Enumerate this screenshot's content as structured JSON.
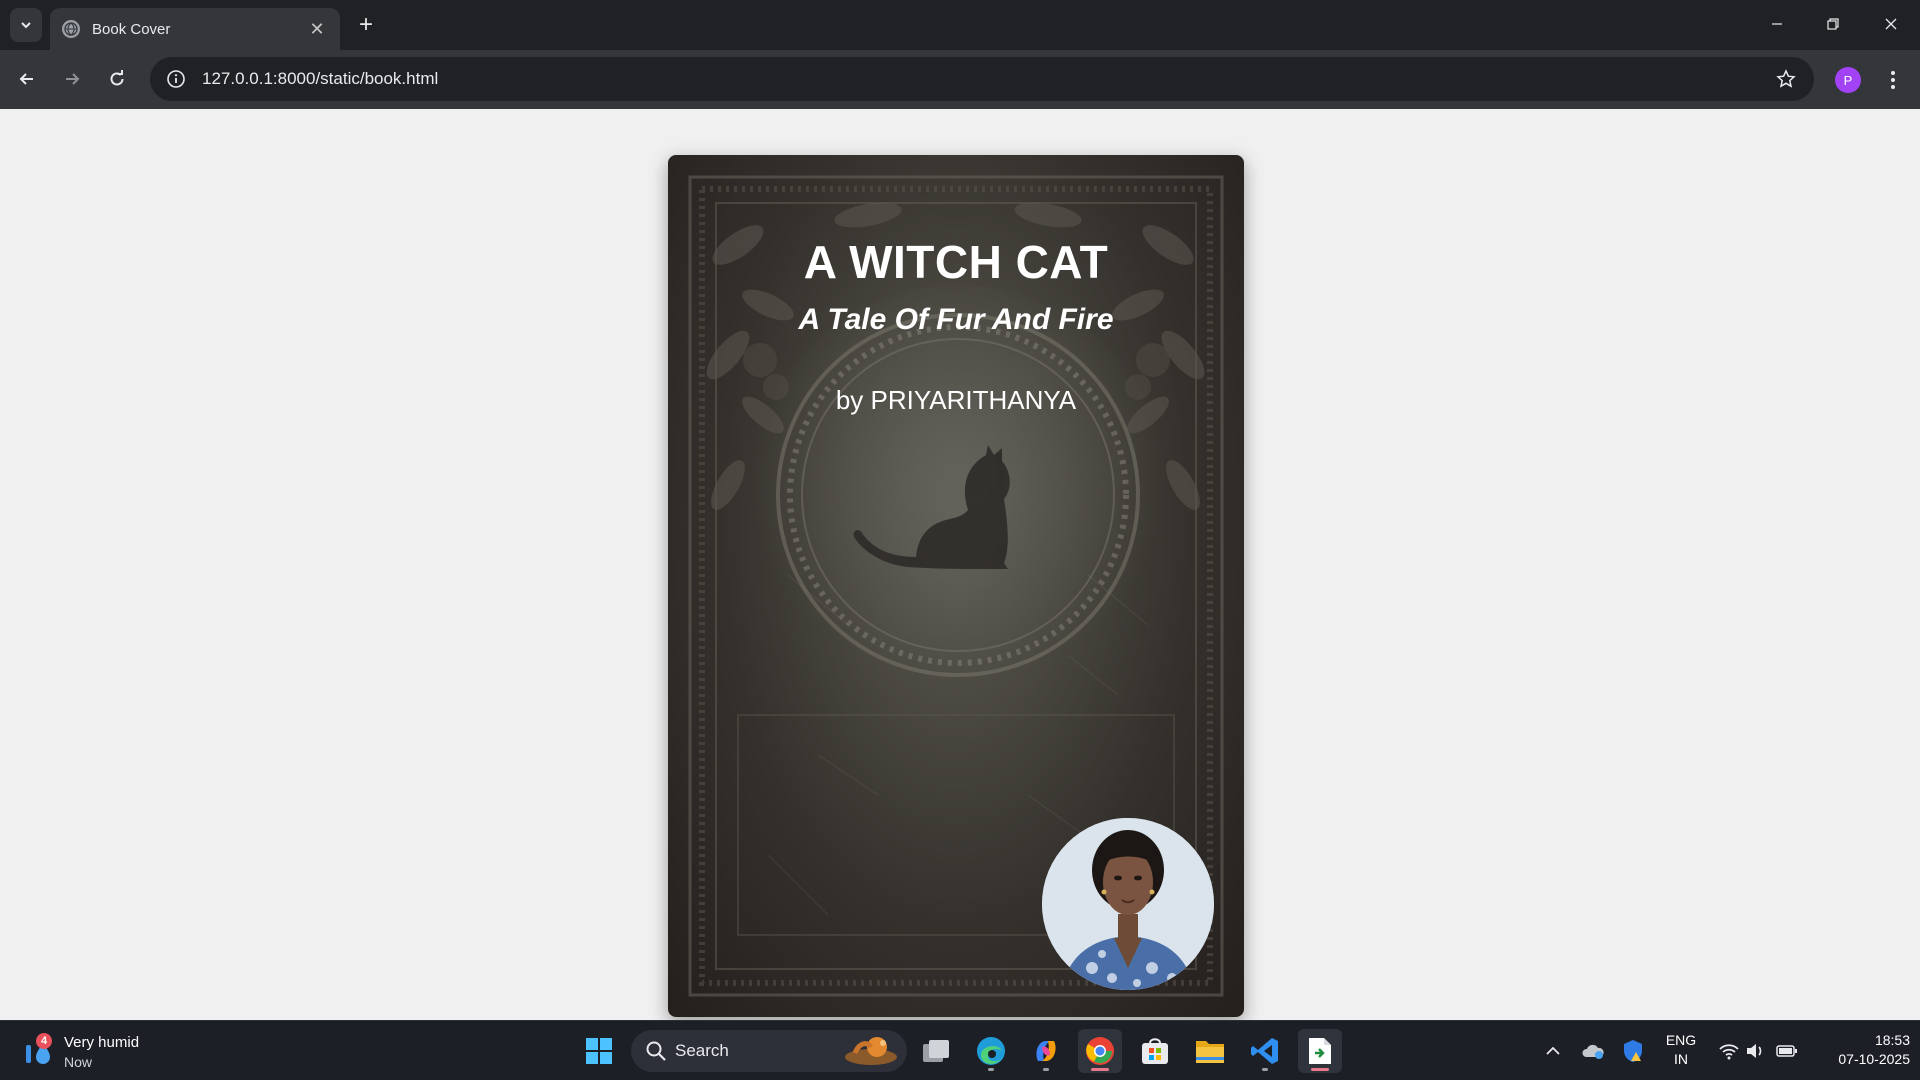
{
  "browser": {
    "tab": {
      "title": "Book Cover",
      "favicon": "globe-icon"
    },
    "address": {
      "url": "127.0.0.1:8000/static/book.html"
    },
    "profile_initial": "P",
    "colors": {
      "chrome_dark": "#202124",
      "chrome_mid": "#35363a",
      "profile": "#a142f4"
    }
  },
  "book": {
    "title": "A WITCH CAT",
    "subtitle": "A Tale Of Fur And Fire",
    "author": "by PRIYARITHANYA",
    "illustration": "black cat silhouette inside ornate circular frame with leafy border",
    "colors": {
      "cover_light": "#5d5c55",
      "cover_dark": "#241f1d",
      "text": "#ffffff"
    }
  },
  "taskbar": {
    "weather": {
      "badge": "4",
      "condition": "Very humid",
      "time": "Now"
    },
    "search_label": "Search",
    "apps": [
      "windows-start-icon",
      "task-view-icon",
      "edge-icon",
      "copilot-icon",
      "chrome-icon",
      "store-icon",
      "file-explorer-icon",
      "vscode-icon",
      "active-app-icon"
    ],
    "language": {
      "line1": "ENG",
      "line2": "IN"
    },
    "clock": {
      "time": "18:53",
      "date": "07-10-2025"
    }
  }
}
